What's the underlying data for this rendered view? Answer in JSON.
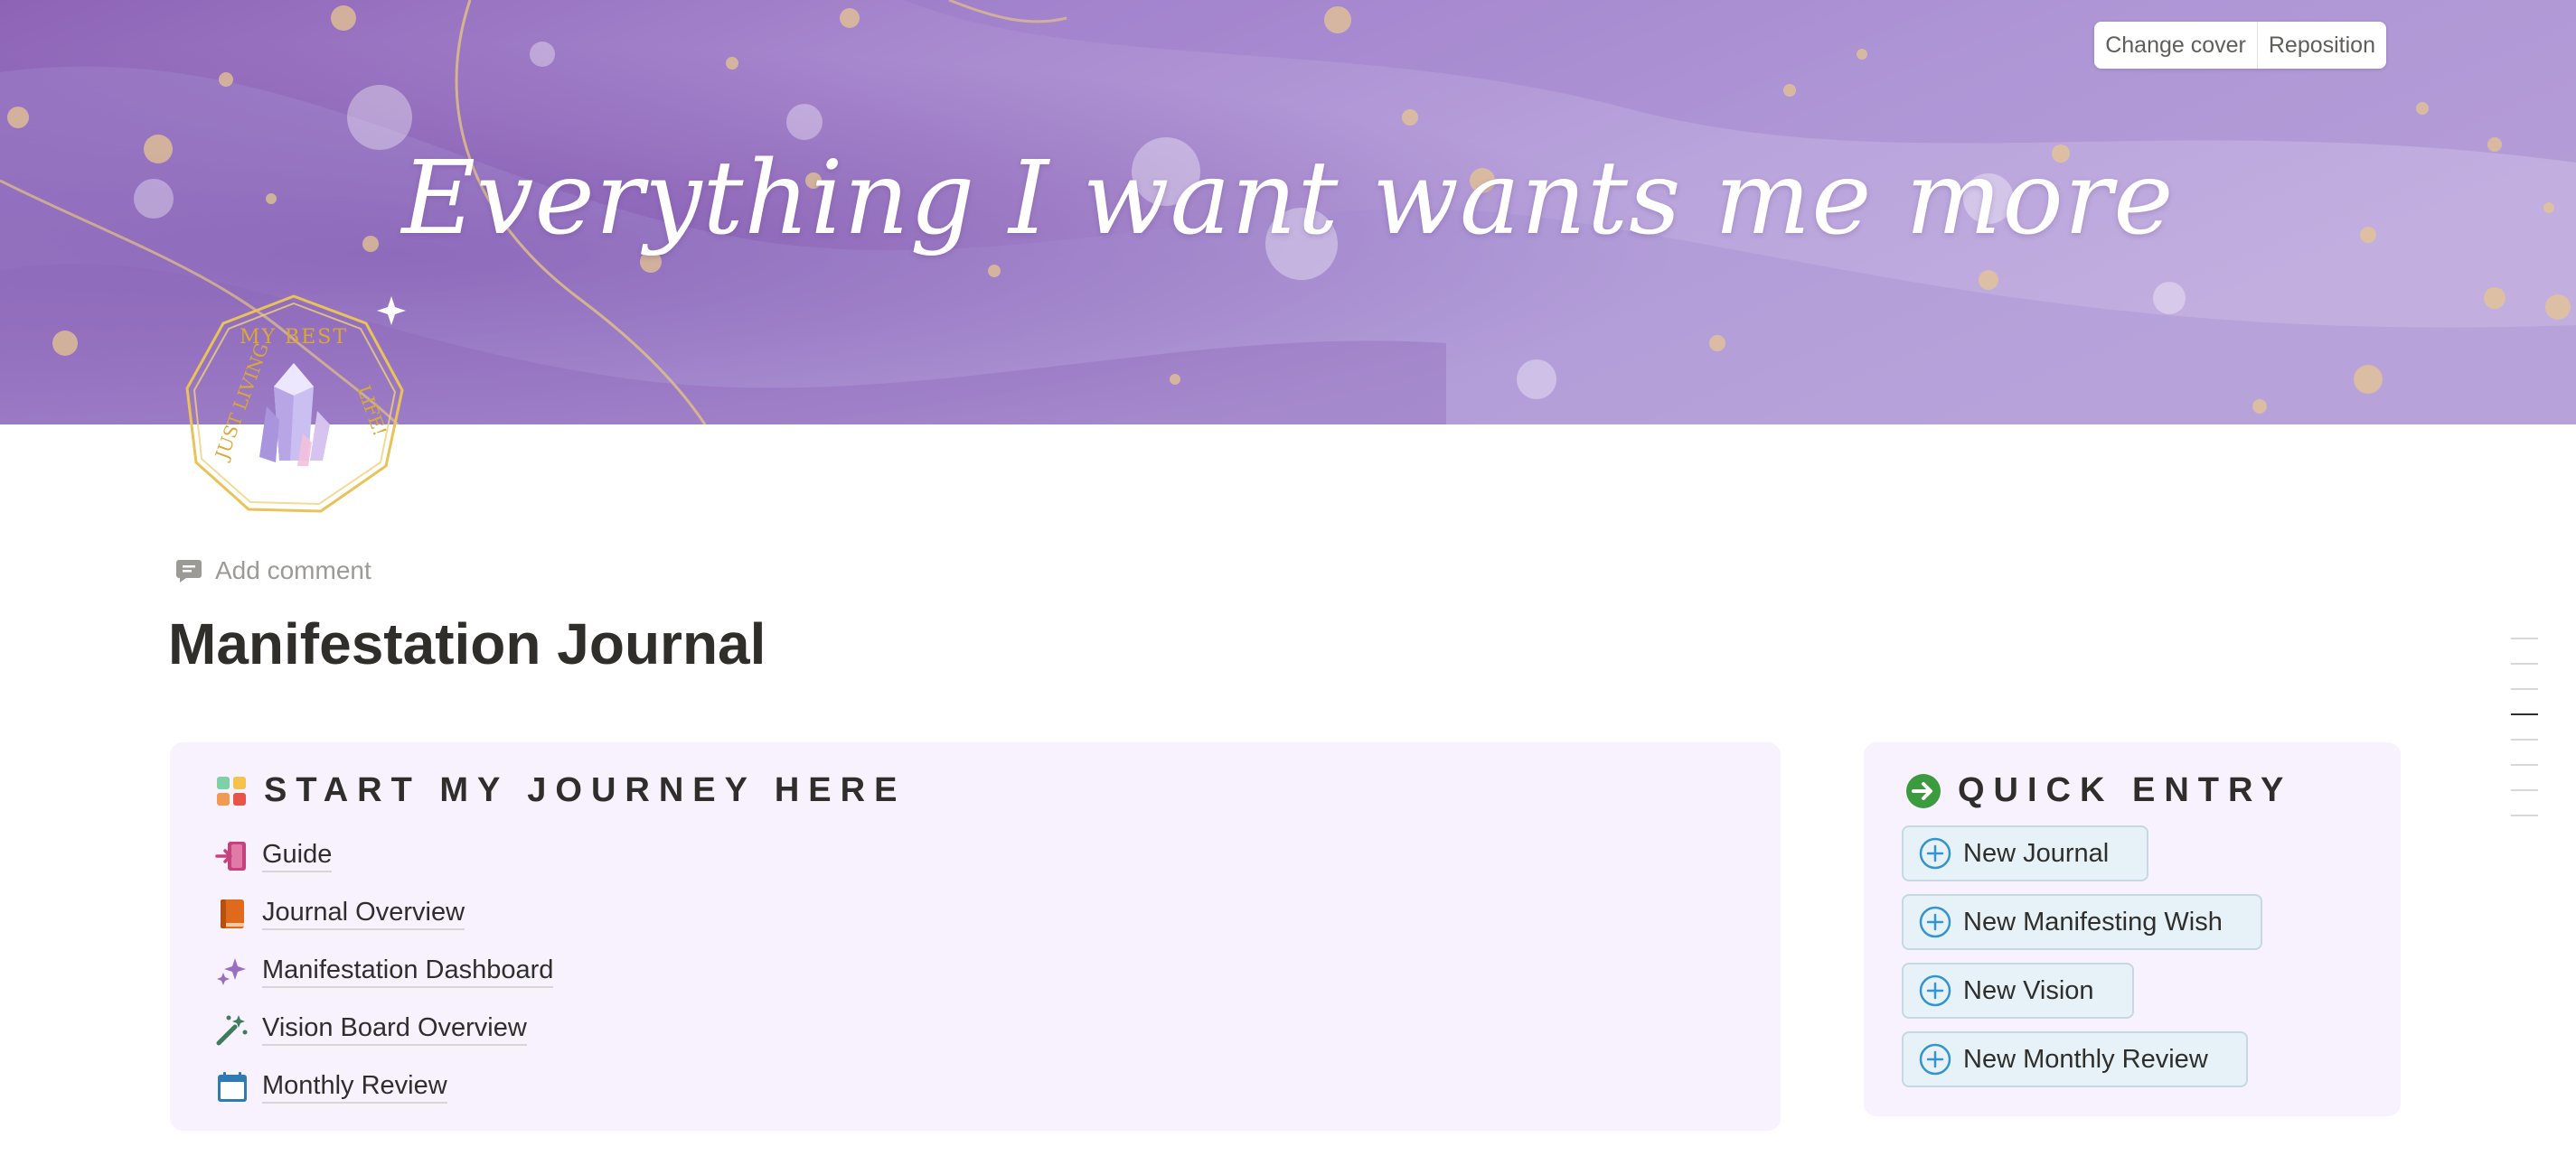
{
  "cover": {
    "quote": "Everything I want wants me more",
    "change_cover": "Change cover",
    "reposition": "Reposition"
  },
  "page_icon": {
    "badge_text": "JUST LIVING MY BEST LIFE!",
    "icon": "crystal-badge-icon"
  },
  "comment": {
    "label": "Add comment",
    "icon": "comment-icon"
  },
  "title": "Manifestation Journal",
  "start_section": {
    "heading": "START MY JOURNEY HERE",
    "icon": "grid-squares-icon",
    "links": [
      {
        "label": "Guide",
        "icon": "enter-door-icon",
        "color": "#c9407e"
      },
      {
        "label": "Journal Overview",
        "icon": "book-icon",
        "color": "#e06a1c"
      },
      {
        "label": "Manifestation Dashboard",
        "icon": "sparkles-icon",
        "color": "#9a6fbf"
      },
      {
        "label": "Vision Board Overview",
        "icon": "magic-wand-icon",
        "color": "#3f7d5a"
      },
      {
        "label": "Monthly Review",
        "icon": "calendar-icon",
        "color": "#2f79b5"
      }
    ]
  },
  "quick_entry": {
    "heading": "QUICK ENTRY",
    "icon": "arrow-circle-icon",
    "buttons": [
      {
        "label": "New Journal",
        "icon": "plus-circle-icon"
      },
      {
        "label": "New Manifesting Wish",
        "icon": "plus-circle-icon"
      },
      {
        "label": "New Vision",
        "icon": "plus-circle-icon"
      },
      {
        "label": "New Monthly Review",
        "icon": "plus-circle-icon"
      }
    ]
  },
  "colors": {
    "cover_purple": "#a98ccf",
    "callout_bg": "#f7f2fd",
    "entry_bg": "#e7f2f8",
    "accent_green": "#3c9a3f",
    "plus_blue": "#3594cf"
  }
}
